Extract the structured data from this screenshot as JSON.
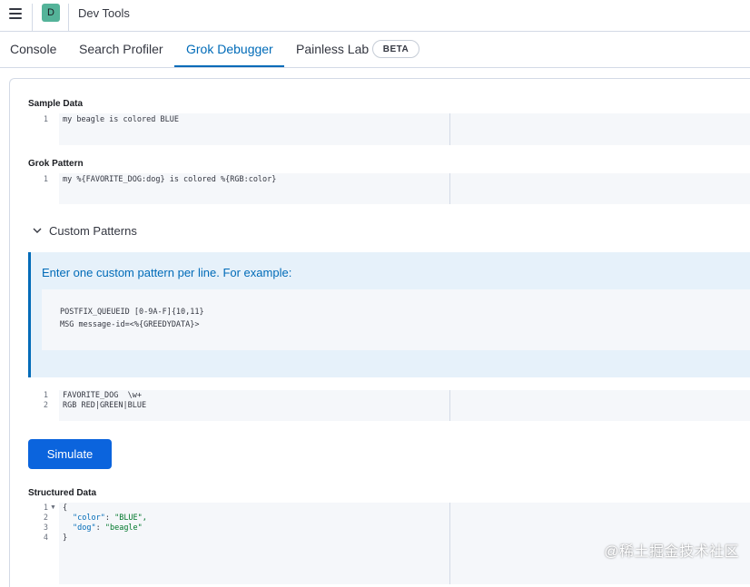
{
  "header": {
    "app_badge": "D",
    "title": "Dev Tools"
  },
  "tabs": [
    {
      "label": "Console"
    },
    {
      "label": "Search Profiler"
    },
    {
      "label": "Grok Debugger"
    },
    {
      "label": "Painless Lab"
    }
  ],
  "active_tab": "Grok Debugger",
  "beta_badge": "BETA",
  "sample_data": {
    "label": "Sample Data",
    "lines": [
      "my beagle is colored BLUE"
    ]
  },
  "grok_pattern": {
    "label": "Grok Pattern",
    "lines": [
      "my %{FAVORITE_DOG:dog} is colored %{RGB:color}"
    ]
  },
  "custom_patterns": {
    "title": "Custom Patterns",
    "callout_text": "Enter one custom pattern per line. For example:",
    "example_lines": [
      "POSTFIX_QUEUEID [0-9A-F]{10,11}",
      "MSG message-id=<%{GREEDYDATA}>"
    ],
    "lines": [
      "FAVORITE_DOG  \\w+",
      "RGB RED|GREEN|BLUE"
    ]
  },
  "simulate_button": "Simulate",
  "structured_data": {
    "label": "Structured Data",
    "open": "{",
    "close": "}",
    "color_key": "\"color\"",
    "color_val": "\"BLUE\",",
    "dog_key": "\"dog\"",
    "dog_val": "\"beagle\""
  },
  "line_numbers": [
    "1",
    "2",
    "3",
    "4"
  ],
  "watermark": "@稀土掘金技术社区"
}
